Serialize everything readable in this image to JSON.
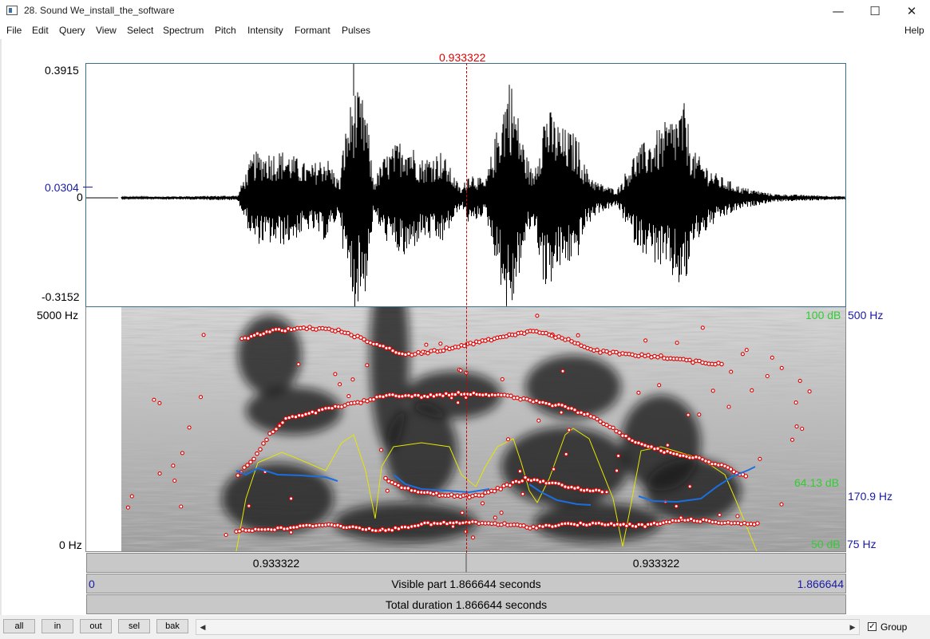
{
  "window": {
    "title": "28. Sound We_install_the_software",
    "minimize_glyph": "—",
    "maximize_glyph": "☐",
    "close_glyph": "✕"
  },
  "menu": {
    "file": "File",
    "edit": "Edit",
    "query": "Query",
    "view": "View",
    "select": "Select",
    "spectrum": "Spectrum",
    "pitch": "Pitch",
    "intensity": "Intensity",
    "formant": "Formant",
    "pulses": "Pulses",
    "help": "Help"
  },
  "waveform": {
    "cursor_time": "0.933322",
    "max_amp": "0.3915",
    "cursor_amp": "0.0304",
    "zero": "0",
    "min_amp": "-0.3152"
  },
  "spectrogram": {
    "max_freq": "5000 Hz",
    "min_freq": "0 Hz",
    "intensity_max": "100 dB",
    "intensity_cursor": "64.13 dB",
    "intensity_min": "50 dB",
    "pitch_max": "500 Hz",
    "pitch_cursor": "170.9 Hz",
    "pitch_min": "75 Hz"
  },
  "time_bars": {
    "left_segment": "0.933322",
    "right_segment": "0.933322",
    "visible_start": "0",
    "visible_label": "Visible part 1.866644 seconds",
    "visible_end": "1.866644",
    "total_label": "Total duration 1.866644 seconds"
  },
  "bottom": {
    "all": "all",
    "in": "in",
    "out": "out",
    "sel": "sel",
    "bak": "bak",
    "scroll_left": "◀",
    "scroll_right": "▶",
    "group_checked": "✓",
    "group_label": "Group"
  },
  "colors": {
    "cursor": "#e00000",
    "pitch_curve": "#1a6fe0",
    "intensity_curve": "#e6e600",
    "formant_dots": "#e00000",
    "blue_labels": "#1a1aa6",
    "green_labels": "#33cc33"
  }
}
